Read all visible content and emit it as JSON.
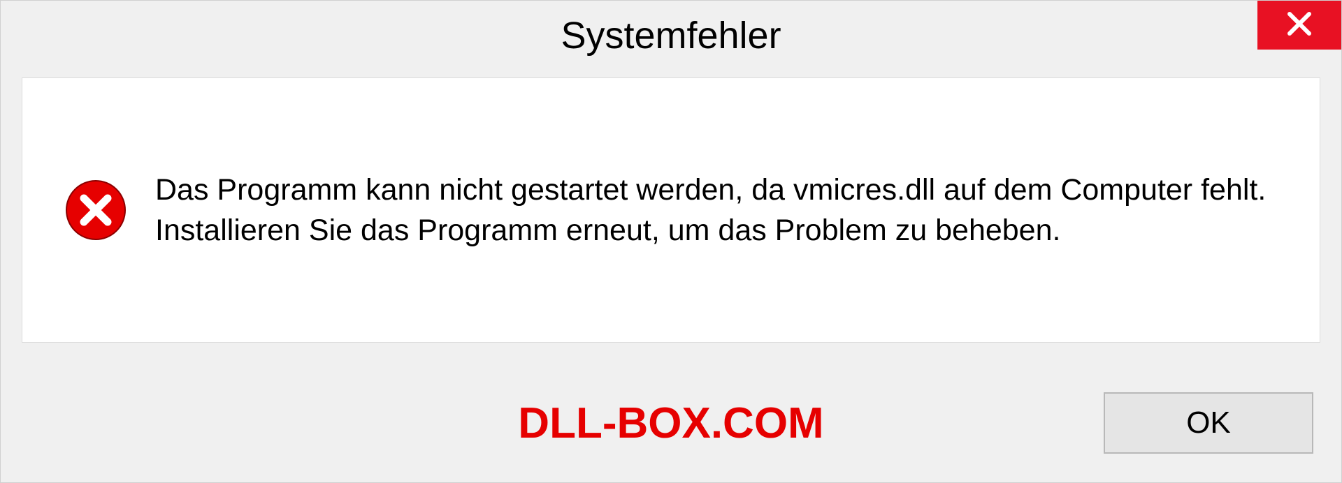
{
  "dialog": {
    "title": "Systemfehler",
    "message": "Das Programm kann nicht gestartet werden, da vmicres.dll auf dem Computer fehlt. Installieren Sie das Programm erneut, um das Problem zu beheben.",
    "ok_label": "OK"
  },
  "watermark": "DLL-BOX.COM"
}
